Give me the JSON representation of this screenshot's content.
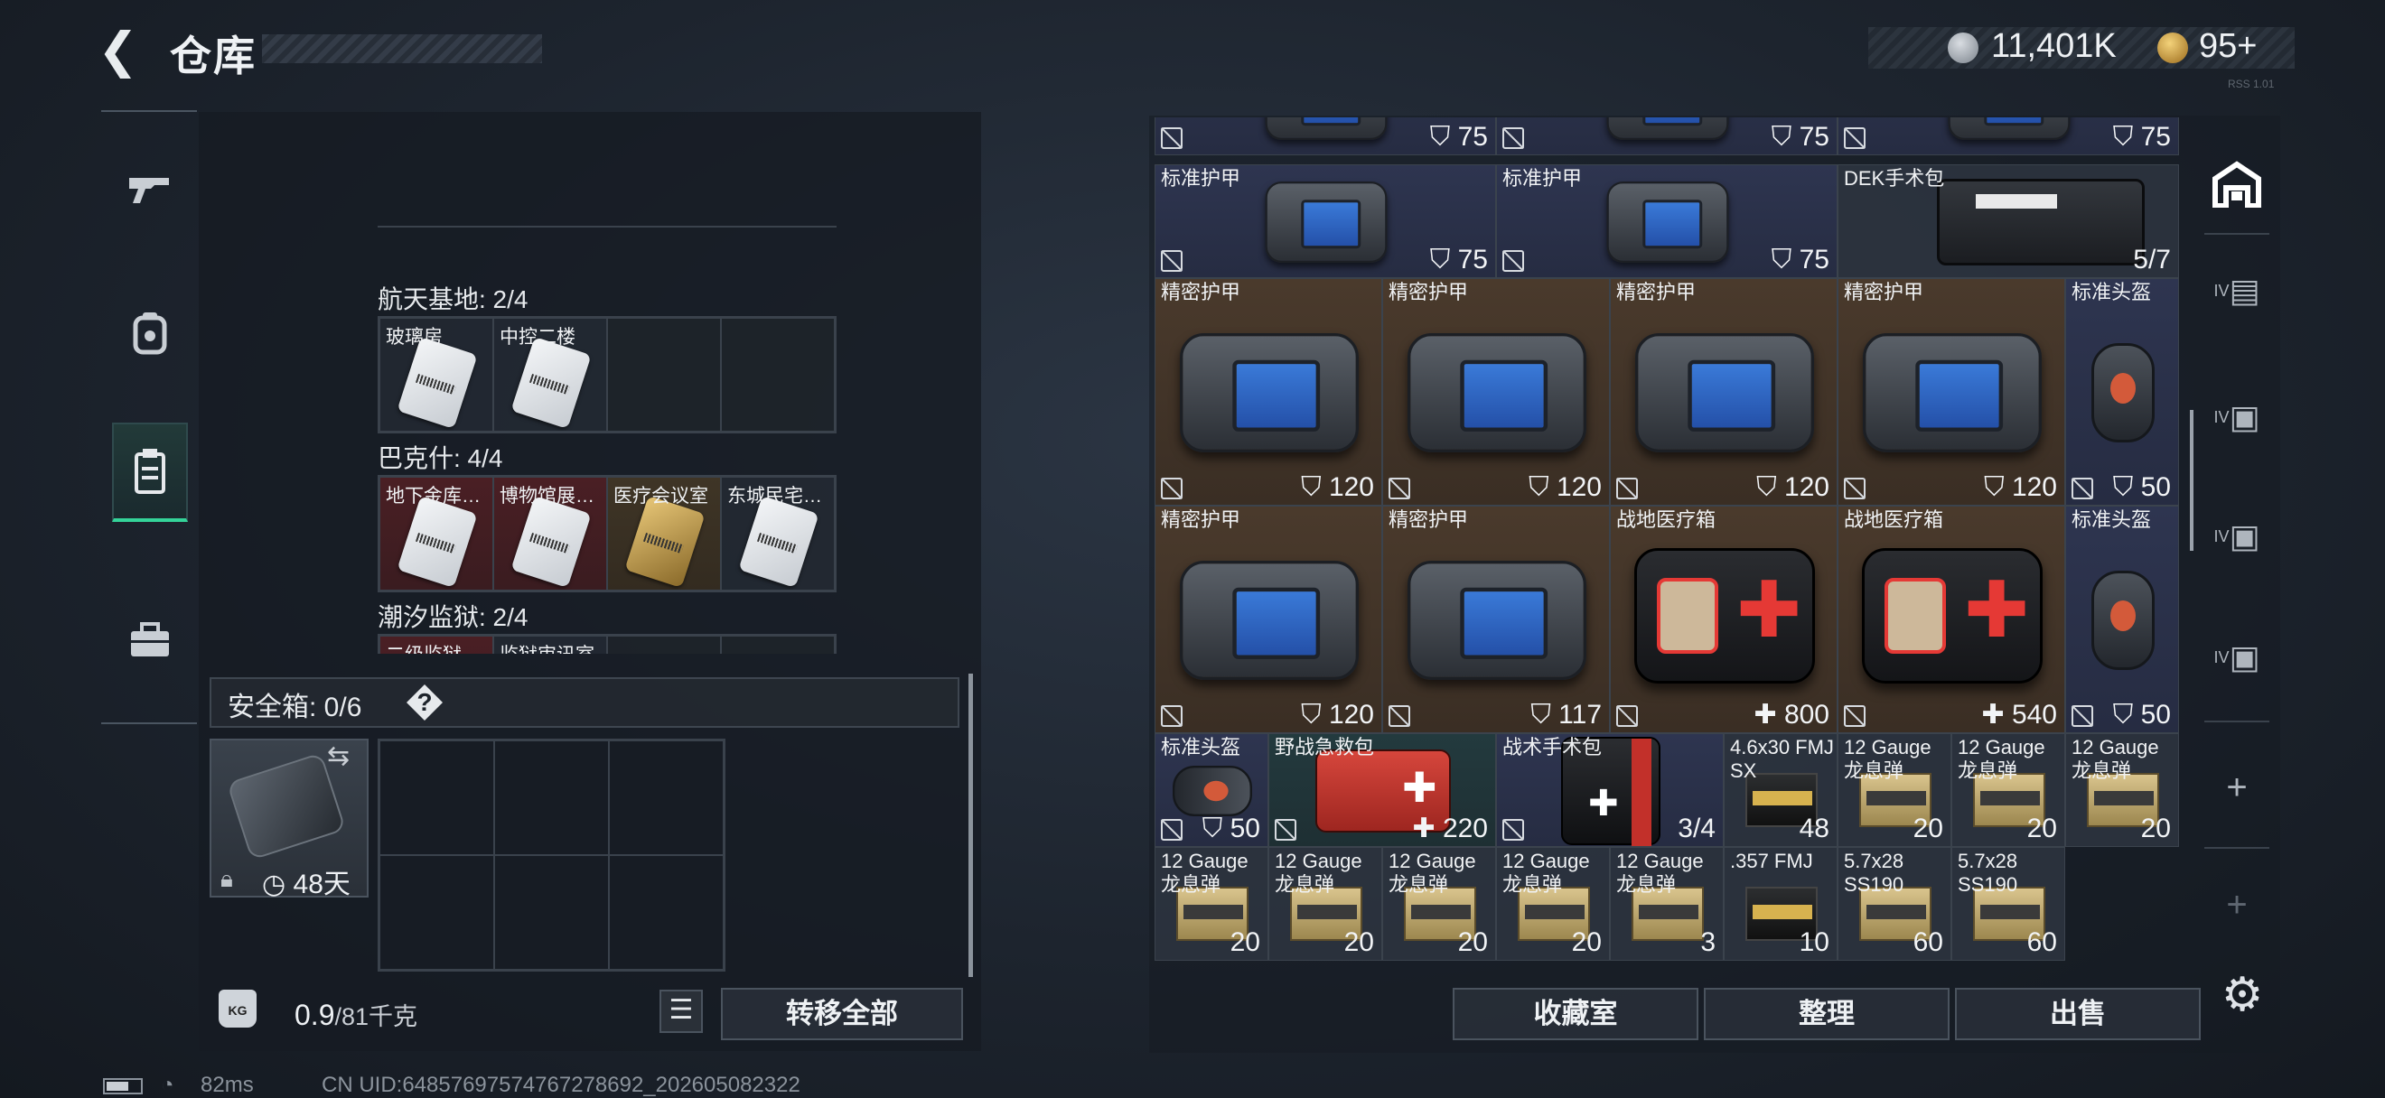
{
  "header": {
    "back_icon": "back-arrow-icon",
    "title": "仓库",
    "currency_silver": "11,401K",
    "currency_gold": "95+",
    "version": "RSS 1.01"
  },
  "left_rail": {
    "items": [
      "gun-icon",
      "backpack-icon",
      "keycard-holder-icon",
      "toolbox-icon"
    ],
    "selected_index": 2
  },
  "keycard_sections": [
    {
      "label": "",
      "cells": [
        {
          "name": "",
          "theme": "red"
        },
        {
          "name": "",
          "theme": "gray"
        },
        {
          "name": "",
          "theme": "gray"
        },
        {
          "name": "",
          "theme": "gray"
        }
      ]
    },
    {
      "label": "航天基地: 2/4",
      "cells": [
        {
          "name": "玻璃房",
          "theme": "gray"
        },
        {
          "name": "中控二楼",
          "theme": "gray"
        },
        {
          "name": "",
          "theme": "empty"
        },
        {
          "name": "",
          "theme": "empty"
        }
      ]
    },
    {
      "label": "巴克什: 4/4",
      "cells": [
        {
          "name": "地下金库…",
          "theme": "red"
        },
        {
          "name": "博物馆展…",
          "theme": "red"
        },
        {
          "name": "医疗会议室",
          "theme": "gold"
        },
        {
          "name": "东城民宅…",
          "theme": "gray"
        }
      ]
    },
    {
      "label": "潮汐监狱: 2/4",
      "cells": [
        {
          "name": "二级监狱…",
          "theme": "red"
        },
        {
          "name": "监狱审讯室",
          "theme": "gray"
        },
        {
          "name": "",
          "theme": "empty"
        },
        {
          "name": "",
          "theme": "empty"
        }
      ]
    }
  ],
  "safe_box": {
    "label": "安全箱: 0/6",
    "help": "?",
    "timer": "48天",
    "slots": 6
  },
  "footer_left": {
    "weight_value": "0.9",
    "weight_total": "/81千克",
    "kg_icon": "KG",
    "transfer_all": "转移全部"
  },
  "stash_items": [
    {
      "name": "",
      "value": "75",
      "kind": "vest",
      "theme": "nv"
    },
    {
      "name": "",
      "value": "75",
      "kind": "vest",
      "theme": "nv"
    },
    {
      "name": "",
      "value": "75",
      "kind": "vest",
      "theme": "nv"
    },
    {
      "name": "标准护甲",
      "value": "75",
      "kind": "vest",
      "theme": "nv"
    },
    {
      "name": "标准护甲",
      "value": "75",
      "kind": "vest",
      "theme": "nv"
    },
    {
      "name": "DEK手术包",
      "value": "5/7",
      "kind": "dek",
      "theme": "gy"
    },
    {
      "name": "精密护甲",
      "value": "120",
      "kind": "vest",
      "theme": "br"
    },
    {
      "name": "精密护甲",
      "value": "120",
      "kind": "vest",
      "theme": "br"
    },
    {
      "name": "精密护甲",
      "value": "120",
      "kind": "vest",
      "theme": "br"
    },
    {
      "name": "精密护甲",
      "value": "120",
      "kind": "vest",
      "theme": "br"
    },
    {
      "name": "标准头盔",
      "value": "50",
      "kind": "helmet",
      "theme": "nv"
    },
    {
      "name": "精密护甲",
      "value": "120",
      "kind": "vest",
      "theme": "br"
    },
    {
      "name": "精密护甲",
      "value": "117",
      "kind": "vest",
      "theme": "br"
    },
    {
      "name": "战地医疗箱",
      "value": "800",
      "kind": "medkit",
      "theme": "br"
    },
    {
      "name": "战地医疗箱",
      "value": "540",
      "kind": "medkit",
      "theme": "br"
    },
    {
      "name": "标准头盔",
      "value": "50",
      "kind": "helmet",
      "theme": "nv"
    },
    {
      "name": "标准头盔",
      "value": "50",
      "kind": "helmet",
      "theme": "nv"
    },
    {
      "name": "野战急救包",
      "value": "220",
      "kind": "redkit",
      "theme": "tl"
    },
    {
      "name": "战术手术包",
      "value": "3/4",
      "kind": "blackkit",
      "theme": "nv"
    },
    {
      "name": "4.6x30 FMJ SX",
      "value": "48",
      "kind": "ammo-dark",
      "theme": "gy"
    },
    {
      "name": "12 Gauge 龙息弹",
      "value": "20",
      "kind": "ammo",
      "theme": "gy"
    },
    {
      "name": "12 Gauge 龙息弹",
      "value": "20",
      "kind": "ammo",
      "theme": "gy"
    },
    {
      "name": "12 Gauge 龙息弹",
      "value": "20",
      "kind": "ammo",
      "theme": "gy"
    },
    {
      "name": "12 Gauge 龙息弹",
      "value": "20",
      "kind": "ammo",
      "theme": "gy"
    },
    {
      "name": "12 Gauge 龙息弹",
      "value": "20",
      "kind": "ammo",
      "theme": "gy"
    },
    {
      "name": "12 Gauge 龙息弹",
      "value": "20",
      "kind": "ammo",
      "theme": "gy"
    },
    {
      "name": "12 Gauge 龙息弹",
      "value": "20",
      "kind": "ammo",
      "theme": "gy"
    },
    {
      "name": "12 Gauge 龙息弹",
      "value": "3",
      "kind": "ammo",
      "theme": "gy"
    },
    {
      "name": ".357 FMJ",
      "value": "10",
      "kind": "ammo-dark",
      "theme": "gy"
    },
    {
      "name": "5.7x28 SS190",
      "value": "60",
      "kind": "ammo",
      "theme": "gy"
    },
    {
      "name": "5.7x28 SS190",
      "value": "60",
      "kind": "ammo",
      "theme": "gy"
    }
  ],
  "right_rail": {
    "items": [
      "warehouse-icon",
      "container-iv-icon",
      "container-iv-icon",
      "container-iv-icon",
      "container-iv-icon",
      "add-icon",
      "add-icon"
    ],
    "labels": [
      "",
      "IV",
      "IV",
      "IV",
      "IV",
      "+",
      "+"
    ]
  },
  "footer_right": {
    "buttons": [
      "收藏室",
      "整理",
      "出售"
    ],
    "settings_icon": "gear-icon"
  },
  "status": {
    "ping": "82ms",
    "uid": "CN UID:6485769757476727869​2_202605082322"
  }
}
